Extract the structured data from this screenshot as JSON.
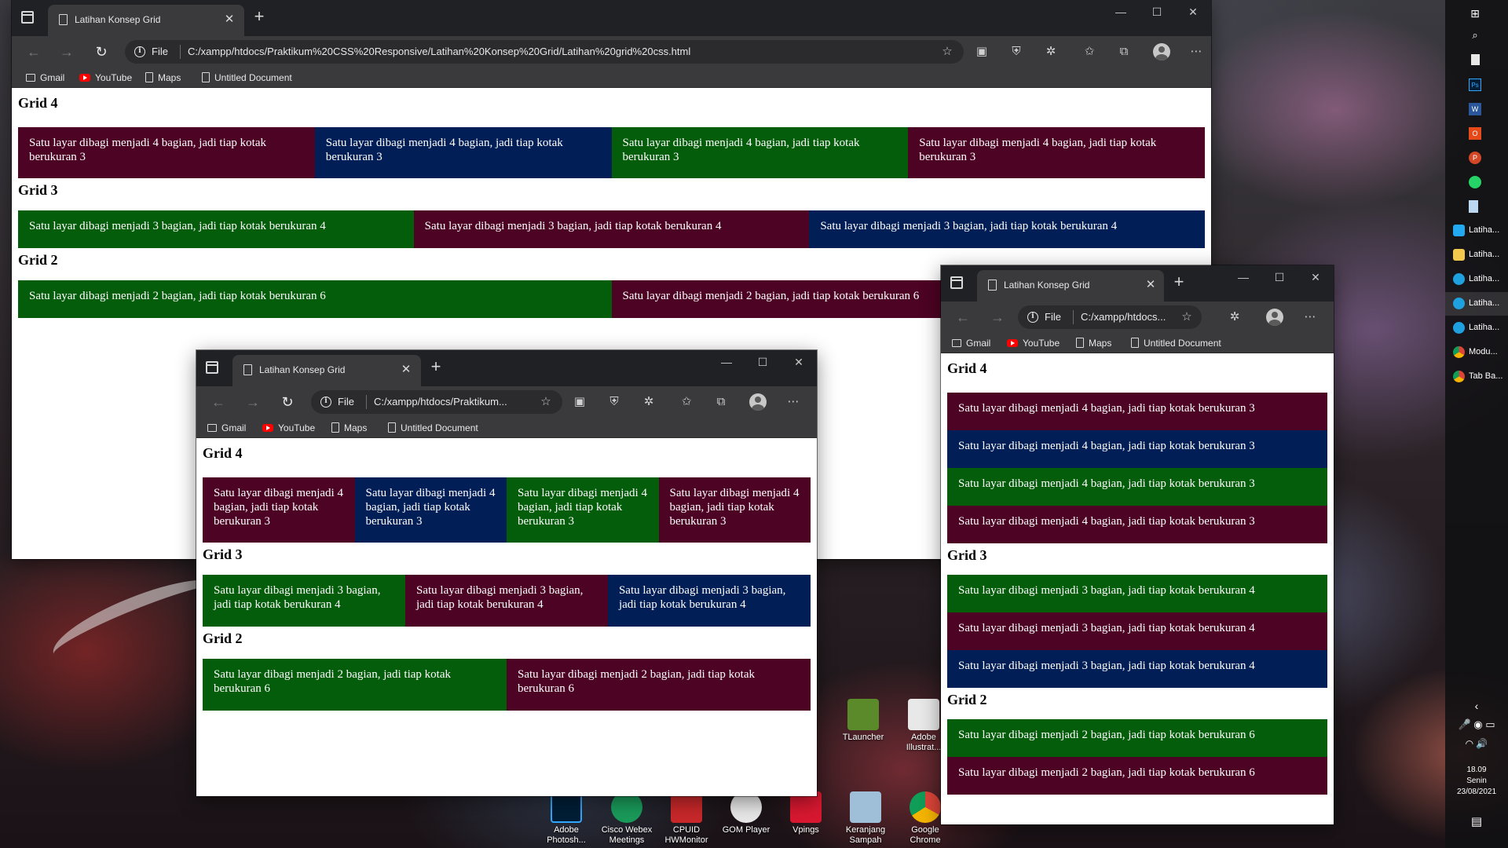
{
  "colors": {
    "maroon": "#4d0323",
    "navy": "#021e57",
    "green": "#045d0a",
    "chrome_dark": "#202124",
    "chrome_toolbar": "#3a3a3c"
  },
  "browser": {
    "tab_title": "Latihan Konsep Grid",
    "file_label": "File",
    "url_full": "C:/xampp/htdocs/Praktikum%20CSS%20Responsive/Latihan%20Konsep%20Grid/Latihan%20grid%20css.html",
    "url_mid": "C:/xampp/htdocs/Praktikum...",
    "url_short": "C:/xampp/htdocs...",
    "bookmarks": [
      "Gmail",
      "YouTube",
      "Maps",
      "Untitled Document"
    ],
    "icons": [
      "tab-actions-icon",
      "page-icon",
      "close-icon",
      "new-tab-icon",
      "back-icon",
      "forward-icon",
      "refresh-icon",
      "info-icon",
      "favorites-add-icon",
      "collections-icon",
      "extensions-icon",
      "favorites-icon",
      "profile-icon",
      "more-icon"
    ]
  },
  "page": {
    "grid4": {
      "heading": "Grid 4",
      "text": "Satu layar dibagi menjadi 4 bagian, jadi tiap kotak berukuran 3"
    },
    "grid3": {
      "heading": "Grid 3",
      "text": "Satu layar dibagi menjadi 3 bagian, jadi tiap kotak berukuran 4"
    },
    "grid2": {
      "heading": "Grid 2",
      "text": "Satu layar dibagi menjadi 2 bagian, jadi tiap kotak berukuran 6"
    }
  },
  "desktop_icons": [
    {
      "label": "TLauncher"
    },
    {
      "label": "Adobe Illustrat..."
    },
    {
      "label": "Adobe Photosh..."
    },
    {
      "label": "Cisco Webex Meetings"
    },
    {
      "label": "CPUID HWMonitor"
    },
    {
      "label": "GOM Player"
    },
    {
      "label": "Vpings"
    },
    {
      "label": "Keranjang Sampah"
    },
    {
      "label": "Google Chrome"
    }
  ],
  "taskbar": {
    "apps": [
      {
        "label": "Latiha..."
      },
      {
        "label": "Latiha..."
      },
      {
        "label": "Latiha..."
      },
      {
        "label": "Latiha..."
      },
      {
        "label": "Latiha..."
      },
      {
        "label": "Modu..."
      },
      {
        "label": "Tab Ba..."
      }
    ],
    "time": "18.09",
    "day": "Senin",
    "date": "23/08/2021"
  }
}
